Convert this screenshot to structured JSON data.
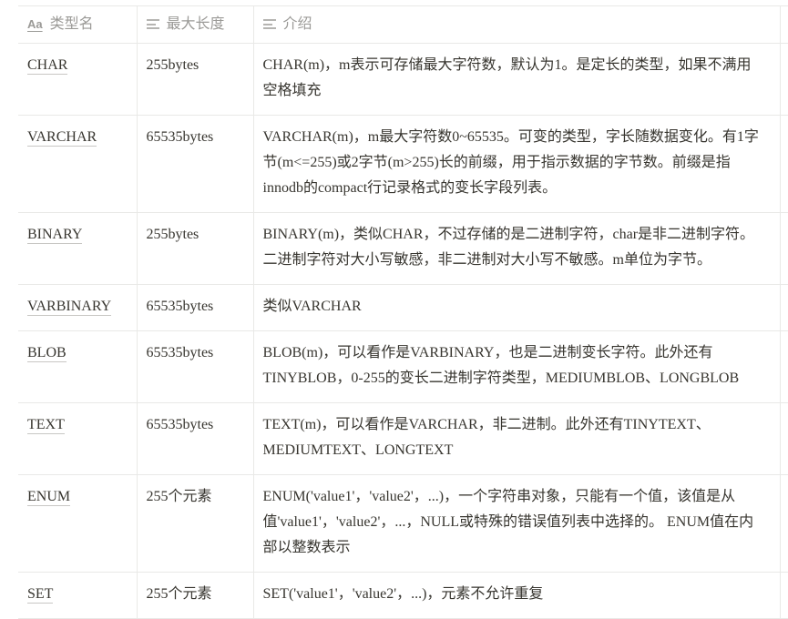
{
  "table": {
    "headers": [
      {
        "icon": "text-type-icon",
        "label": "类型名"
      },
      {
        "icon": "text-lines-icon",
        "label": "最大长度"
      },
      {
        "icon": "text-lines-icon",
        "label": "介绍"
      }
    ],
    "rows": [
      {
        "name": "CHAR",
        "max_length": "255bytes",
        "description": "CHAR(m)，m表示可存储最大字符数，默认为1。是定长的类型，如果不满用空格填充"
      },
      {
        "name": "VARCHAR",
        "max_length": "65535bytes",
        "description": "VARCHAR(m)，m最大字符数0~65535。可变的类型，字长随数据变化。有1字节(m<=255)或2字节(m>255)长的前缀，用于指示数据的字节数。前缀是指innodb的compact行记录格式的变长字段列表。"
      },
      {
        "name": "BINARY",
        "max_length": "255bytes",
        "description": "BINARY(m)，类似CHAR，不过存储的是二进制字符，char是非二进制字符。二进制字符对大小写敏感，非二进制对大小写不敏感。m单位为字节。"
      },
      {
        "name": "VARBINARY",
        "max_length": "65535bytes",
        "description": "类似VARCHAR"
      },
      {
        "name": "BLOB",
        "max_length": "65535bytes",
        "description": "BLOB(m)，可以看作是VARBINARY，也是二进制变长字符。此外还有TINYBLOB，0-255的变长二进制字符类型，MEDIUMBLOB、LONGBLOB"
      },
      {
        "name": "TEXT",
        "max_length": "65535bytes",
        "description": "TEXT(m)，可以看作是VARCHAR，非二进制。此外还有TINYTEXT、MEDIUMTEXT、LONGTEXT"
      },
      {
        "name": "ENUM",
        "max_length": "255个元素",
        "description": "ENUM('value1'，'value2'，...)，一个字符串对象，只能有一个值，该值是从值'value1'，'value2'，...，NULL或特殊的错误值列表中选择的。 ENUM值在内部以整数表示"
      },
      {
        "name": "SET",
        "max_length": "255个元素",
        "description": "SET('value1'，'value2'，...)，元素不允许重复"
      }
    ]
  }
}
